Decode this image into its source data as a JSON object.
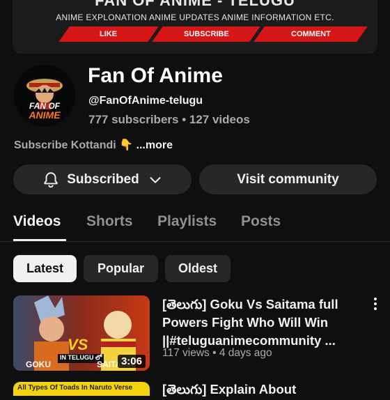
{
  "banner": {
    "title": "FAN OF ANIME - TELUGU",
    "subtitle": "ANIME EXPLONATION ANIME UPDATES ANIME INFORMATION ETC.",
    "like": "LIKE",
    "subscribe": "SUBSCRIBE",
    "comment": "COMMENT"
  },
  "channel": {
    "avatar_text_1": "FAN OF",
    "avatar_text_2": "ANIME",
    "name": "Fan Of Anime",
    "handle": "@FanOfAnime-telugu",
    "stats": "777 subscribers • 127 videos",
    "description": "Subscribe Kottandi 👇",
    "more": "...more"
  },
  "actions": {
    "subscribed": "Subscribed",
    "visit_community": "Visit community"
  },
  "tabs": [
    "Videos",
    "Shorts",
    "Playlists",
    "Posts"
  ],
  "chips": [
    "Latest",
    "Popular",
    "Oldest"
  ],
  "videos": [
    {
      "title": "[తెలుగు] Goku Vs Saitama full Powers Fight Who Will Win ||#teluguanimecommunity ...",
      "meta": "117 views • 4 days ago",
      "duration": "3:06",
      "thumb_text_vs": "VS",
      "thumb_text_mid": "IN TELUGU లో",
      "thumb_text_left": "GOKU",
      "thumb_text_right": "SAITAMA"
    },
    {
      "title": "[తెలుగు] Explain About",
      "thumb_text": "All Types Of Toads In Naruto Verse"
    }
  ],
  "colors": {
    "background": "#0f0f0f",
    "pill": "#272727",
    "banner_red": "#d61616",
    "muted_text": "#aaaaaa"
  }
}
